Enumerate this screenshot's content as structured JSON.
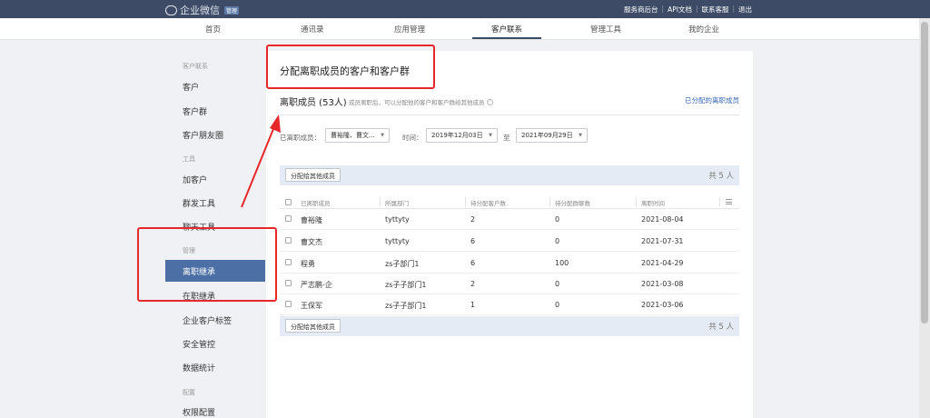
{
  "brand": {
    "logo_text": "企业微信",
    "badge": "管理"
  },
  "top_links": [
    "服务商后台",
    "API文档",
    "联系客服",
    "退出"
  ],
  "top_link_sep": "|",
  "nav": {
    "items": [
      "首页",
      "通讯录",
      "应用管理",
      "客户联系",
      "管理工具",
      "我的企业"
    ],
    "active_index": 3
  },
  "sidebar": {
    "group_customer": "客户联系",
    "customer": "客户",
    "customer_group": "客户群",
    "moments": "客户朋友圈",
    "group_tools": "工具",
    "add_customer": "加客户",
    "mass_send": "群发工具",
    "chat_tools": "聊天工具",
    "group_manage": "管理",
    "resigned_inherit": "离职继承",
    "onjob_inherit": "在职继承",
    "tags": "企业客户标签",
    "security": "安全管控",
    "stats": "数据统计",
    "group_config": "配置",
    "permissions": "权限配置"
  },
  "page": {
    "title": "分配离职成员的客户和客户群",
    "subtitle": "离职成员 (53人)",
    "desc": "成员离职后，可以分配他的客户和客户群给其他成员",
    "info_glyph": "?",
    "assigned_link": "已分配的离职成员"
  },
  "filters": {
    "member_label": "已离职成员：",
    "member_value": "曹裕隆、曹文...",
    "time_label": "时间：",
    "date_from": "2019年12月03日",
    "to_label": "至",
    "date_to": "2021年09月29日",
    "caret": "▼"
  },
  "bulk": {
    "button": "分配给其他成员",
    "count": "共 5 人"
  },
  "table": {
    "headers": [
      "已离职成员",
      "所属部门",
      "待分配客户数",
      "待分配群聊数",
      "离职时间"
    ],
    "rows": [
      {
        "name": "曹裕隆",
        "dept": "tyttyty",
        "customers": "2",
        "groups": "0",
        "date": "2021-08-04"
      },
      {
        "name": "曹文杰",
        "dept": "tyttyty",
        "customers": "6",
        "groups": "0",
        "date": "2021-07-31"
      },
      {
        "name": "程勇",
        "dept": "zs子部门1",
        "customers": "6",
        "groups": "100",
        "date": "2021-04-29"
      },
      {
        "name": "严志鹏-企",
        "dept": "zs子子部门1",
        "customers": "2",
        "groups": "0",
        "date": "2021-03-08"
      },
      {
        "name": "王保军",
        "dept": "zs子子部门1",
        "customers": "1",
        "groups": "0",
        "date": "2021-03-06"
      }
    ]
  },
  "colors": {
    "accent": "#4c6fa6",
    "topbar": "#3d4b66",
    "annotation": "#e8272b",
    "link": "#3667b7"
  }
}
